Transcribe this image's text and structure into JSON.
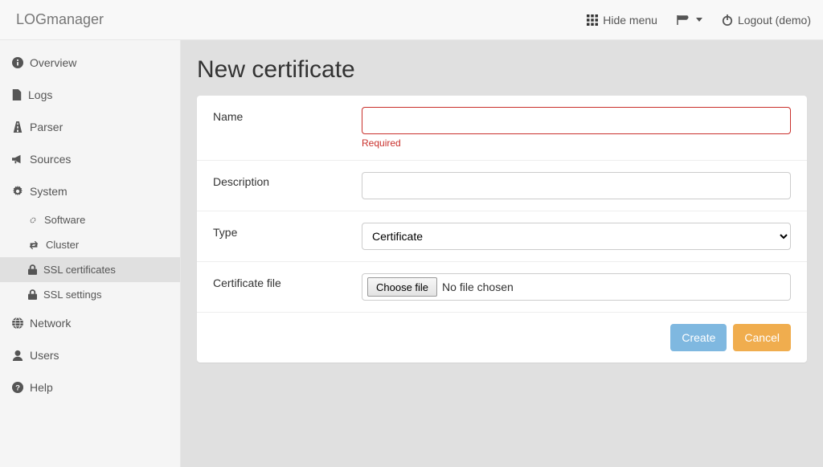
{
  "brand": "LOGmanager",
  "topbar": {
    "hide_menu": "Hide menu",
    "logout": "Logout (demo)"
  },
  "sidebar": {
    "items": [
      {
        "icon": "info-circle-icon",
        "label": "Overview"
      },
      {
        "icon": "file-icon",
        "label": "Logs"
      },
      {
        "icon": "road-icon",
        "label": "Parser"
      },
      {
        "icon": "bullhorn-icon",
        "label": "Sources"
      },
      {
        "icon": "gear-icon",
        "label": "System"
      },
      {
        "icon": "globe-icon",
        "label": "Network"
      },
      {
        "icon": "user-icon",
        "label": "Users"
      },
      {
        "icon": "question-circle-icon",
        "label": "Help"
      }
    ],
    "system_sub": [
      {
        "icon": "link-icon",
        "label": "Software"
      },
      {
        "icon": "retweet-icon",
        "label": "Cluster"
      },
      {
        "icon": "lock-icon",
        "label": "SSL certificates",
        "active": true
      },
      {
        "icon": "lock-icon",
        "label": "SSL settings"
      }
    ]
  },
  "page": {
    "title": "New certificate",
    "fields": {
      "name": {
        "label": "Name",
        "value": "",
        "error": "Required"
      },
      "description": {
        "label": "Description",
        "value": ""
      },
      "type": {
        "label": "Type",
        "selected": "Certificate"
      },
      "file": {
        "label": "Certificate file",
        "button": "Choose file",
        "status": "No file chosen"
      }
    },
    "actions": {
      "create": "Create",
      "cancel": "Cancel"
    }
  }
}
